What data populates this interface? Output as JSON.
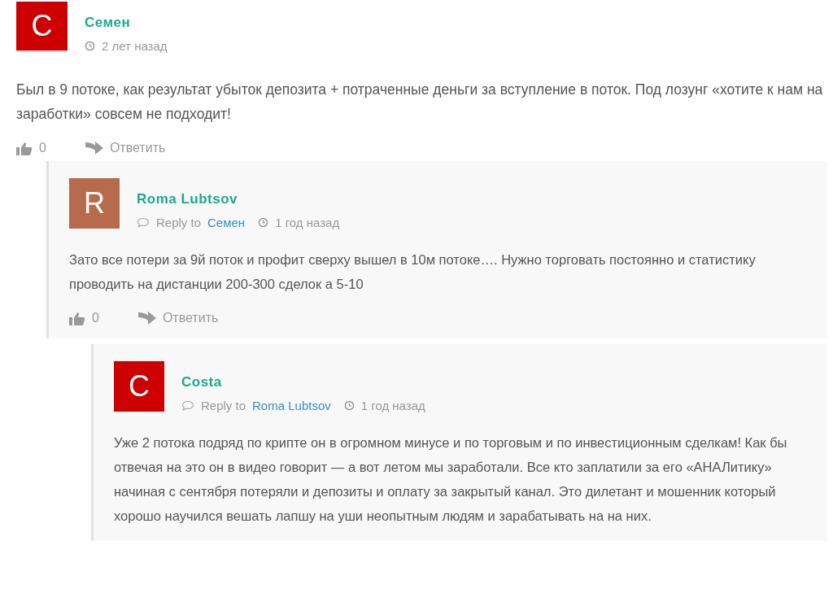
{
  "comments": [
    {
      "author": "Семен",
      "avatar_letter": "С",
      "color": "#cc0000",
      "time": "2 лет назад",
      "text": "Был в 9 потоке, как результат убыток депозита + потраченные деньги за вступление в поток. Под лозунг «хотите к нам на заработки» совсем не подходит!",
      "likes": "0",
      "reply_label": "Ответить",
      "children": [
        {
          "author": "Roma Lubtsov",
          "avatar_letter": "R",
          "color": "#b86b4b",
          "reply_prefix": "Reply to",
          "reply_to": "Семен",
          "time": "1 год назад",
          "text": "Зато все потери за 9й поток и профит сверху вышел в 10м потоке…. Нужно торговать постоянно и статистику проводить на дистанции 200-300 сделок а 5-10",
          "likes": "0",
          "reply_label": "Ответить",
          "children": [
            {
              "author": "Costa",
              "avatar_letter": "С",
              "color": "#cc0000",
              "reply_prefix": "Reply to",
              "reply_to": "Roma Lubtsov",
              "time": "1 год назад",
              "text": "Уже 2 потока подряд по крипте он в огромном минусе и по торговым и по инвестиционным сделкам! Как бы отвечая на это он в видео говорит — а вот летом мы заработали. Все кто заплатили за его «АНАЛитику» начиная с сентября потеряли и депозиты и оплату за закрытый канал. Это дилетант и мошенник который хорошо научился вешать лапшу на уши неопытным людям и зарабатывать на на них."
            }
          ]
        }
      ]
    }
  ]
}
